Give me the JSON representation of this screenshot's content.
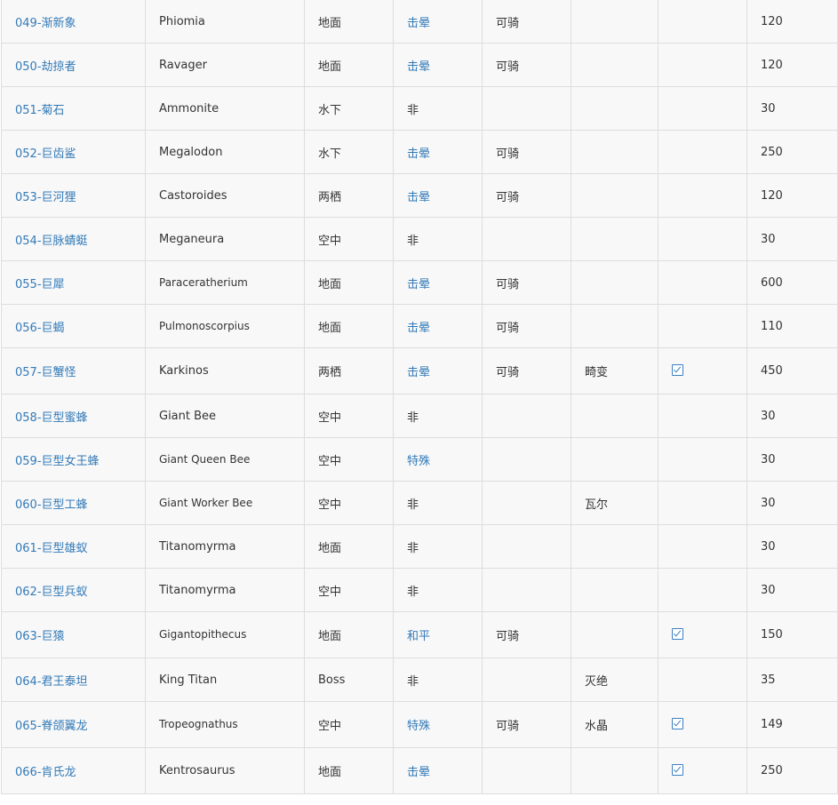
{
  "rows": [
    {
      "id": "049-渐新象",
      "latin": "Phiomia",
      "habitat": "地面",
      "taming": "击晕",
      "taming_link": true,
      "ride": "可骑",
      "variant": "",
      "check": false,
      "value": "120"
    },
    {
      "id": "050-劫掠者",
      "latin": "Ravager",
      "habitat": "地面",
      "taming": "击晕",
      "taming_link": true,
      "ride": "可骑",
      "variant": "",
      "check": false,
      "value": "120"
    },
    {
      "id": "051-菊石",
      "latin": "Ammonite",
      "habitat": "水下",
      "taming": "非",
      "taming_link": false,
      "ride": "",
      "variant": "",
      "check": false,
      "value": "30"
    },
    {
      "id": "052-巨齿鲨",
      "latin": "Megalodon",
      "habitat": "水下",
      "taming": "击晕",
      "taming_link": true,
      "ride": "可骑",
      "variant": "",
      "check": false,
      "value": "250"
    },
    {
      "id": "053-巨河狸",
      "latin": "Castoroides",
      "habitat": "两栖",
      "taming": "击晕",
      "taming_link": true,
      "ride": "可骑",
      "variant": "",
      "check": false,
      "value": "120"
    },
    {
      "id": "054-巨脉蜻蜓",
      "latin": "Meganeura",
      "habitat": "空中",
      "taming": "非",
      "taming_link": false,
      "ride": "",
      "variant": "",
      "check": false,
      "value": "30"
    },
    {
      "id": "055-巨犀",
      "latin": "Paraceratherium",
      "habitat": "地面",
      "taming": "击晕",
      "taming_link": true,
      "ride": "可骑",
      "variant": "",
      "check": false,
      "value": "600"
    },
    {
      "id": "056-巨蝎",
      "latin": "Pulmonoscorpius",
      "habitat": "地面",
      "taming": "击晕",
      "taming_link": true,
      "ride": "可骑",
      "variant": "",
      "check": false,
      "value": "110"
    },
    {
      "id": "057-巨蟹怪",
      "latin": "Karkinos",
      "habitat": "两栖",
      "taming": "击晕",
      "taming_link": true,
      "ride": "可骑",
      "variant": "畸变",
      "check": true,
      "value": "450"
    },
    {
      "id": "058-巨型蜜蜂",
      "latin": "Giant Bee",
      "habitat": "空中",
      "taming": "非",
      "taming_link": false,
      "ride": "",
      "variant": "",
      "check": false,
      "value": "30"
    },
    {
      "id": "059-巨型女王蜂",
      "latin": "Giant Queen Bee",
      "habitat": "空中",
      "taming": "特殊",
      "taming_link": true,
      "ride": "",
      "variant": "",
      "check": false,
      "value": "30"
    },
    {
      "id": "060-巨型工蜂",
      "latin": "Giant Worker Bee",
      "habitat": "空中",
      "taming": "非",
      "taming_link": false,
      "ride": "",
      "variant": "瓦尔",
      "check": false,
      "value": "30"
    },
    {
      "id": "061-巨型雄蚁",
      "latin": "Titanomyrma",
      "habitat": "地面",
      "taming": "非",
      "taming_link": false,
      "ride": "",
      "variant": "",
      "check": false,
      "value": "30"
    },
    {
      "id": "062-巨型兵蚁",
      "latin": "Titanomyrma",
      "habitat": "空中",
      "taming": "非",
      "taming_link": false,
      "ride": "",
      "variant": "",
      "check": false,
      "value": "30"
    },
    {
      "id": "063-巨猿",
      "latin": "Gigantopithecus",
      "habitat": "地面",
      "taming": "和平",
      "taming_link": true,
      "ride": "可骑",
      "variant": "",
      "check": true,
      "value": "150"
    },
    {
      "id": "064-君王泰坦",
      "latin": "King Titan",
      "habitat": "Boss",
      "taming": "非",
      "taming_link": false,
      "ride": "",
      "variant": "灭绝",
      "check": false,
      "value": "35"
    },
    {
      "id": "065-脊颌翼龙",
      "latin": "Tropeognathus",
      "habitat": "空中",
      "taming": "特殊",
      "taming_link": true,
      "ride": "可骑",
      "variant": "水晶",
      "check": true,
      "value": "149"
    },
    {
      "id": "066-肯氏龙",
      "latin": "Kentrosaurus",
      "habitat": "地面",
      "taming": "击晕",
      "taming_link": true,
      "ride": "",
      "variant": "",
      "check": true,
      "value": "250"
    }
  ],
  "colors": {
    "link": "#337ab7",
    "text": "#333333",
    "border": "#dddddd",
    "row_bg": "#f8f8f8"
  }
}
